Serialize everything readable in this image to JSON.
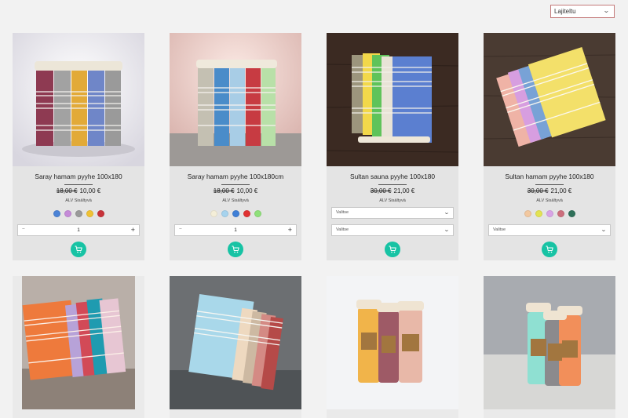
{
  "sort": {
    "label": "Lajiteltu"
  },
  "products": [
    {
      "title": "Saray hamam pyyhe 100x180",
      "old_price": "18,00 €",
      "price": "10,00 €",
      "vat": "ALV Sisältyvä",
      "swatches": [
        "#4b83d6",
        "#c58bd8",
        "#9a9a9a",
        "#f0c234",
        "#c8333a"
      ],
      "quantity": "1",
      "minus": "−",
      "plus": "+"
    },
    {
      "title": "Saray hamam pyyhe 100x180cm",
      "old_price": "18,00 €",
      "price": "10,00 €",
      "vat": "ALV Sisältyvä",
      "swatches": [
        "#f4eed8",
        "#a6d3ee",
        "#3f7fd6",
        "#e03232",
        "#8fe07a"
      ],
      "quantity": "1",
      "minus": "−",
      "plus": "+"
    },
    {
      "title": "Sultan sauna pyyhe 100x180",
      "old_price": "30,00 €",
      "price": "21,00 €",
      "vat": "ALV Sisältyvä",
      "select_1": "Valitse",
      "select_2": "Valitse"
    },
    {
      "title": "Sultan hamam pyyhe 100x180",
      "old_price": "30,00 €",
      "price": "21,00 €",
      "vat": "ALV Sisältyvä",
      "swatches": [
        "#f2c8a0",
        "#e3e353",
        "#d8a4e6",
        "#cc6f7d",
        "#2f7059"
      ],
      "select_1": "Valitse"
    },
    {},
    {},
    {},
    {}
  ],
  "icons": {
    "cart": "shopping-cart-icon",
    "chevron": "chevron-down-icon"
  }
}
